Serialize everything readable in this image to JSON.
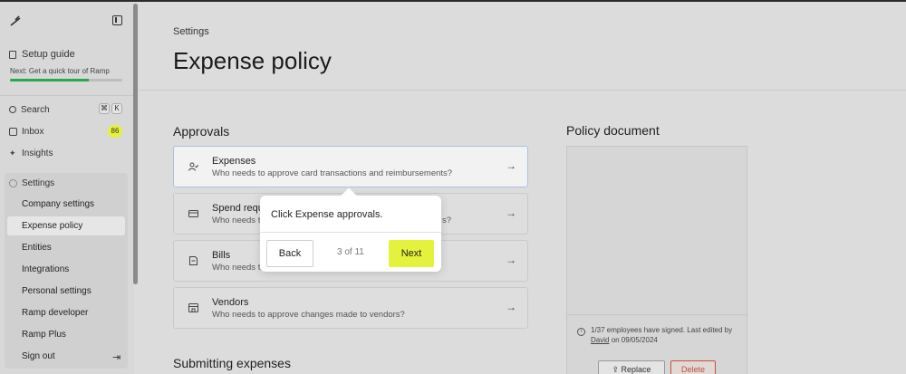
{
  "sidebar": {
    "setup_guide": "Setup guide",
    "setup_next": "Next: Get a quick tour of Ramp",
    "setup_progress_fraction": 0.7,
    "nav": {
      "search": "Search",
      "search_shortcut_1": "⌘",
      "search_shortcut_2": "K",
      "inbox": "Inbox",
      "inbox_count": "86",
      "insights": "Insights",
      "settings": "Settings"
    },
    "settings_items": [
      "Company settings",
      "Expense policy",
      "Entities",
      "Integrations",
      "Personal settings",
      "Ramp developer",
      "Ramp Plus",
      "Sign out"
    ],
    "active_item": "Expense policy"
  },
  "main": {
    "breadcrumb": "Settings",
    "title": "Expense policy",
    "approvals_title": "Approvals",
    "cards": [
      {
        "title": "Expenses",
        "desc": "Who needs to approve card transactions and reimbursements?"
      },
      {
        "title": "Spend requ",
        "desc": "Who needs to",
        "desc_tail": "s?"
      },
      {
        "title": "Bills",
        "desc": "Who needs to"
      },
      {
        "title": "Vendors",
        "desc": "Who needs to approve changes made to vendors?"
      }
    ],
    "submitting_title": "Submitting expenses"
  },
  "policy": {
    "title": "Policy document",
    "info_text": "1/37 employees have signed. Last edited by",
    "info_author": "David",
    "info_date": "on 09/05/2024",
    "replace_label": "Replace",
    "delete_label": "Delete"
  },
  "popover": {
    "text": "Click Expense approvals.",
    "back_label": "Back",
    "step_label": "3 of 11",
    "next_label": "Next"
  },
  "colors": {
    "accent_yellow": "#e4f23b",
    "progress_green": "#2aa84a",
    "delete_red": "#c0533d"
  }
}
